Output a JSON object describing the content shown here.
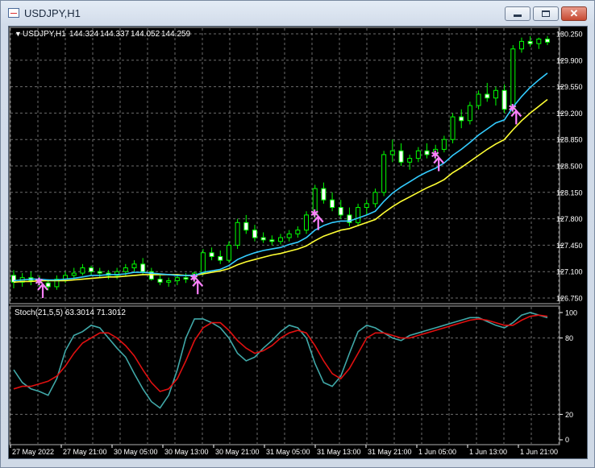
{
  "window": {
    "title": "USDJPY,H1"
  },
  "main_chart": {
    "header": {
      "arrow": "▼",
      "symbol_label": "USDJPY,H1",
      "open": "144.324",
      "high": "144.337",
      "low": "144.052",
      "close": "144.259"
    },
    "price_labels": [
      "130.250",
      "129.900",
      "129.550",
      "129.200",
      "128.850",
      "128.500",
      "128.150",
      "127.800",
      "127.450",
      "127.100",
      "126.750"
    ]
  },
  "stoch": {
    "header": "Stoch(21,5,5) 63.3014 71.3012",
    "level_labels": [
      "100",
      "80",
      "20",
      "0"
    ]
  },
  "time_labels": [
    "27 May 2022",
    "27 May 21:00",
    "30 May 05:00",
    "30 May 13:00",
    "30 May 21:00",
    "31 May 05:00",
    "31 May 13:00",
    "31 May 21:00",
    "1 Jun 05:00",
    "1 Jun 13:00",
    "1 Jun 21:00"
  ],
  "colors": {
    "background": "#000000",
    "grid": "#9a9a9a",
    "bull_candle": "#00ff00",
    "bear_candle": "#ffffff",
    "ma_fast": "#33ccff",
    "ma_slow": "#ffff33",
    "stoch_main": "#40a8a8",
    "stoch_signal": "#e01010",
    "signal_marker": "#ff80ff"
  },
  "chart_data": [
    {
      "type": "candlestick",
      "ylim": [
        126.75,
        130.25
      ],
      "series": [
        {
          "values": [
            [
              127.05,
              127.12,
              126.88,
              126.96
            ],
            [
              126.96,
              127.08,
              126.9,
              127.02
            ],
            [
              127.02,
              127.1,
              126.92,
              126.98
            ],
            [
              126.98,
              127.05,
              126.9,
              126.95
            ],
            [
              126.95,
              127.0,
              126.85,
              126.9
            ],
            [
              126.9,
              127.05,
              126.86,
              127.0
            ],
            [
              127.0,
              127.1,
              126.95,
              127.05
            ],
            [
              127.05,
              127.15,
              127.0,
              127.08
            ],
            [
              127.08,
              127.2,
              127.05,
              127.15
            ],
            [
              127.15,
              127.18,
              127.05,
              127.1
            ],
            [
              127.1,
              127.15,
              127.02,
              127.08
            ],
            [
              127.08,
              127.12,
              127.0,
              127.05
            ],
            [
              127.05,
              127.15,
              127.0,
              127.1
            ],
            [
              127.1,
              127.2,
              127.05,
              127.15
            ],
            [
              127.15,
              127.25,
              127.1,
              127.2
            ],
            [
              127.2,
              127.28,
              127.05,
              127.1
            ],
            [
              127.1,
              127.15,
              126.98,
              127.0
            ],
            [
              127.0,
              127.05,
              126.92,
              126.96
            ],
            [
              126.96,
              127.02,
              126.9,
              126.98
            ],
            [
              126.98,
              127.05,
              126.92,
              127.02
            ],
            [
              127.02,
              127.08,
              126.95,
              127.0
            ],
            [
              127.0,
              127.1,
              126.95,
              127.08
            ],
            [
              127.08,
              127.4,
              127.05,
              127.35
            ],
            [
              127.35,
              127.42,
              127.25,
              127.3
            ],
            [
              127.3,
              127.38,
              127.2,
              127.25
            ],
            [
              127.25,
              127.5,
              127.22,
              127.45
            ],
            [
              127.45,
              127.8,
              127.4,
              127.75
            ],
            [
              127.75,
              127.85,
              127.6,
              127.65
            ],
            [
              127.65,
              127.72,
              127.5,
              127.55
            ],
            [
              127.55,
              127.62,
              127.48,
              127.52
            ],
            [
              127.52,
              127.58,
              127.45,
              127.5
            ],
            [
              127.5,
              127.6,
              127.46,
              127.55
            ],
            [
              127.55,
              127.65,
              127.5,
              127.6
            ],
            [
              127.6,
              127.7,
              127.55,
              127.65
            ],
            [
              127.65,
              127.9,
              127.6,
              127.85
            ],
            [
              127.85,
              128.25,
              127.8,
              128.2
            ],
            [
              128.2,
              128.28,
              128.0,
              128.05
            ],
            [
              128.05,
              128.15,
              127.9,
              127.95
            ],
            [
              127.95,
              128.05,
              127.8,
              127.85
            ],
            [
              127.85,
              127.95,
              127.7,
              127.75
            ],
            [
              127.75,
              128.0,
              127.7,
              127.95
            ],
            [
              127.95,
              128.05,
              127.85,
              128.0
            ],
            [
              128.0,
              128.2,
              127.95,
              128.15
            ],
            [
              128.15,
              128.7,
              128.1,
              128.65
            ],
            [
              128.65,
              128.85,
              128.55,
              128.7
            ],
            [
              128.7,
              128.8,
              128.5,
              128.55
            ],
            [
              128.55,
              128.65,
              128.45,
              128.6
            ],
            [
              128.6,
              128.75,
              128.55,
              128.7
            ],
            [
              128.7,
              128.8,
              128.6,
              128.65
            ],
            [
              128.65,
              128.78,
              128.58,
              128.72
            ],
            [
              128.72,
              128.9,
              128.68,
              128.85
            ],
            [
              128.85,
              129.2,
              128.8,
              129.15
            ],
            [
              129.15,
              129.25,
              129.0,
              129.1
            ],
            [
              129.1,
              129.35,
              129.05,
              129.3
            ],
            [
              129.3,
              129.5,
              129.25,
              129.45
            ],
            [
              129.45,
              129.6,
              129.35,
              129.4
            ],
            [
              129.4,
              129.55,
              129.3,
              129.5
            ],
            [
              129.5,
              129.58,
              129.2,
              129.25
            ],
            [
              129.25,
              130.1,
              129.2,
              130.05
            ],
            [
              130.05,
              130.2,
              130.0,
              130.15
            ],
            [
              130.15,
              130.22,
              130.08,
              130.12
            ],
            [
              130.12,
              130.2,
              130.05,
              130.18
            ],
            [
              130.18,
              130.22,
              130.1,
              130.14
            ]
          ]
        },
        {
          "name": "",
          "values": [
            126.98,
            126.99,
            127.0,
            127.0,
            126.99,
            126.99,
            127.0,
            127.01,
            127.03,
            127.05,
            127.05,
            127.06,
            127.06,
            127.07,
            127.09,
            127.09,
            127.08,
            127.07,
            127.06,
            127.05,
            127.05,
            127.05,
            127.09,
            127.11,
            127.13,
            127.18,
            127.26,
            127.31,
            127.35,
            127.38,
            127.4,
            127.42,
            127.46,
            127.49,
            127.55,
            127.65,
            127.71,
            127.75,
            127.77,
            127.77,
            127.81,
            127.85,
            127.9,
            128.03,
            128.14,
            128.22,
            128.29,
            128.36,
            128.42,
            128.47,
            128.54,
            128.64,
            128.72,
            128.81,
            128.91,
            128.99,
            129.07,
            129.11,
            129.28,
            129.42,
            129.54,
            129.64,
            129.73
          ]
        },
        {
          "name": "",
          "values": [
            126.96,
            126.97,
            126.97,
            126.98,
            126.98,
            126.98,
            126.98,
            126.99,
            127.0,
            127.01,
            127.02,
            127.03,
            127.03,
            127.04,
            127.05,
            127.06,
            127.06,
            127.06,
            127.06,
            127.06,
            127.05,
            127.05,
            127.07,
            127.09,
            127.11,
            127.14,
            127.19,
            127.23,
            127.26,
            127.29,
            127.32,
            127.34,
            127.37,
            127.4,
            127.44,
            127.51,
            127.57,
            127.61,
            127.65,
            127.67,
            127.71,
            127.75,
            127.79,
            127.88,
            127.96,
            128.03,
            128.09,
            128.15,
            128.21,
            128.26,
            128.32,
            128.41,
            128.48,
            128.56,
            128.64,
            128.72,
            128.79,
            128.85,
            128.98,
            129.1,
            129.2,
            129.29,
            129.38
          ]
        }
      ]
    },
    {
      "type": "line",
      "ylim": [
        0,
        100
      ],
      "series": [
        {
          "name": "",
          "values": [
            55,
            45,
            40,
            38,
            35,
            48,
            70,
            82,
            85,
            90,
            88,
            80,
            72,
            65,
            52,
            40,
            30,
            25,
            35,
            55,
            80,
            95,
            95,
            92,
            88,
            80,
            68,
            62,
            65,
            72,
            78,
            85,
            90,
            88,
            80,
            60,
            45,
            42,
            50,
            68,
            85,
            90,
            88,
            84,
            80,
            78,
            82,
            84,
            86,
            88,
            90,
            92,
            94,
            96,
            96,
            93,
            90,
            88,
            92,
            98,
            100,
            98,
            96
          ]
        },
        {
          "name": "",
          "values": [
            40,
            42,
            42,
            44,
            46,
            50,
            58,
            68,
            76,
            80,
            84,
            84,
            80,
            74,
            66,
            55,
            45,
            38,
            40,
            48,
            62,
            78,
            88,
            92,
            92,
            86,
            78,
            72,
            68,
            70,
            74,
            80,
            84,
            86,
            84,
            74,
            62,
            52,
            48,
            56,
            68,
            80,
            84,
            84,
            82,
            80,
            80,
            82,
            84,
            86,
            88,
            90,
            92,
            94,
            95,
            94,
            92,
            90,
            90,
            94,
            97,
            98,
            97
          ]
        }
      ]
    }
  ]
}
